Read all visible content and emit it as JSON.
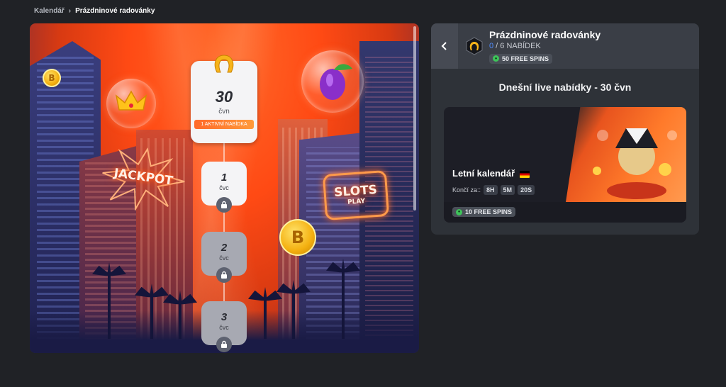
{
  "breadcrumb": {
    "items": [
      "Kalendář",
      "Prázdninové radovánky"
    ]
  },
  "calendar": {
    "active_day": {
      "number": "30",
      "month": "čvn",
      "badge": "1 AKTIVNÍ NABÍDKA"
    },
    "locked_days": [
      {
        "number": "1",
        "month": "čvc"
      },
      {
        "number": "2",
        "month": "čvc"
      },
      {
        "number": "3",
        "month": "čvc"
      }
    ],
    "scene_signs": {
      "jackpot": "JACKPOT",
      "slots": "SLOTS",
      "slots_sub": "PLAY"
    }
  },
  "panel": {
    "title": "Prázdninové radovánky",
    "progress_done": "0",
    "progress_rest": " / 6 NABÍDEK",
    "reward": "50 FREE SPINS",
    "section_title": "Dnešní live nabídky - 30 čvn",
    "offer": {
      "title": "Letní kalendář",
      "ends_label": "Končí za::",
      "time": [
        "8H",
        "5M",
        "20S"
      ],
      "reward": "10 FREE SPINS"
    }
  },
  "colors": {
    "accent_orange": "#ff6a2a",
    "progress_blue": "#4f8cff",
    "reward_green": "#3ec45a"
  }
}
